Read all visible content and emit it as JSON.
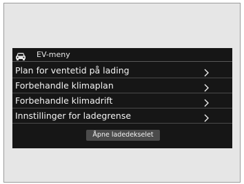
{
  "menu": {
    "title": "EV-meny",
    "header_icon": "car-icon",
    "items": [
      {
        "label": "Plan for ventetid på lading",
        "icon": "chevron-right-icon"
      },
      {
        "label": "Forbehandle klimaplan",
        "icon": "chevron-right-icon"
      },
      {
        "label": "Forbehandle klimadrift",
        "icon": "chevron-right-icon"
      },
      {
        "label": "Innstillinger for ladegrense",
        "icon": "chevron-right-icon"
      }
    ],
    "button_label": "Åpne ladedekselet"
  },
  "colors": {
    "screen_background": "#161616",
    "outer_background": "#e6e6e6",
    "button_background": "#4b4b4b",
    "text": "#f4f4f4"
  }
}
